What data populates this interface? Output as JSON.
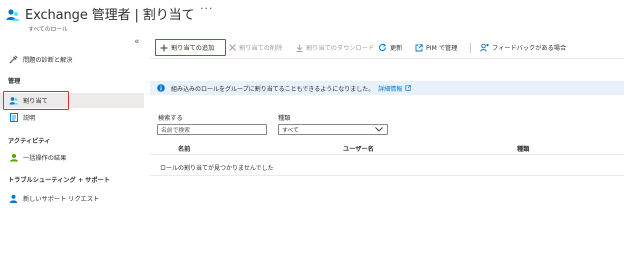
{
  "header": {
    "title": "Exchange 管理者 | 割り当て",
    "more": "···",
    "subtitle": "すべてのロール"
  },
  "sidebar": {
    "collapse_icon": "«",
    "diagnose": "問題の診断と解決",
    "section_manage": "管理",
    "assignments": "割り当て",
    "description": "説明",
    "section_activity": "アクティビティ",
    "bulk_results": "一括操作の結果",
    "section_support": "トラブルシューティング + サポート",
    "new_support": "新しいサポート リクエスト"
  },
  "toolbar": {
    "add": "割り当ての追加",
    "remove": "割り当ての削除",
    "download": "割り当てのダウンロード",
    "refresh": "更新",
    "pim": "PIM で管理",
    "feedback": "フィードバックがある場合"
  },
  "info": {
    "text": "組み込みのロールをグループに割り当てることもできるようになりました。",
    "link": "詳細情報"
  },
  "filters": {
    "search_label": "検索する",
    "search_placeholder": "名前で検索",
    "type_label": "種類",
    "type_value": "すべて"
  },
  "table": {
    "columns": [
      "名前",
      "ユーザー名",
      "種類"
    ],
    "empty": "ロールの割り当てが見つかりませんでした"
  },
  "colors": {
    "accent": "#0078d4",
    "highlight": "#d13438",
    "info_bg": "#e8f1fa",
    "active_bg": "#edebe9"
  }
}
